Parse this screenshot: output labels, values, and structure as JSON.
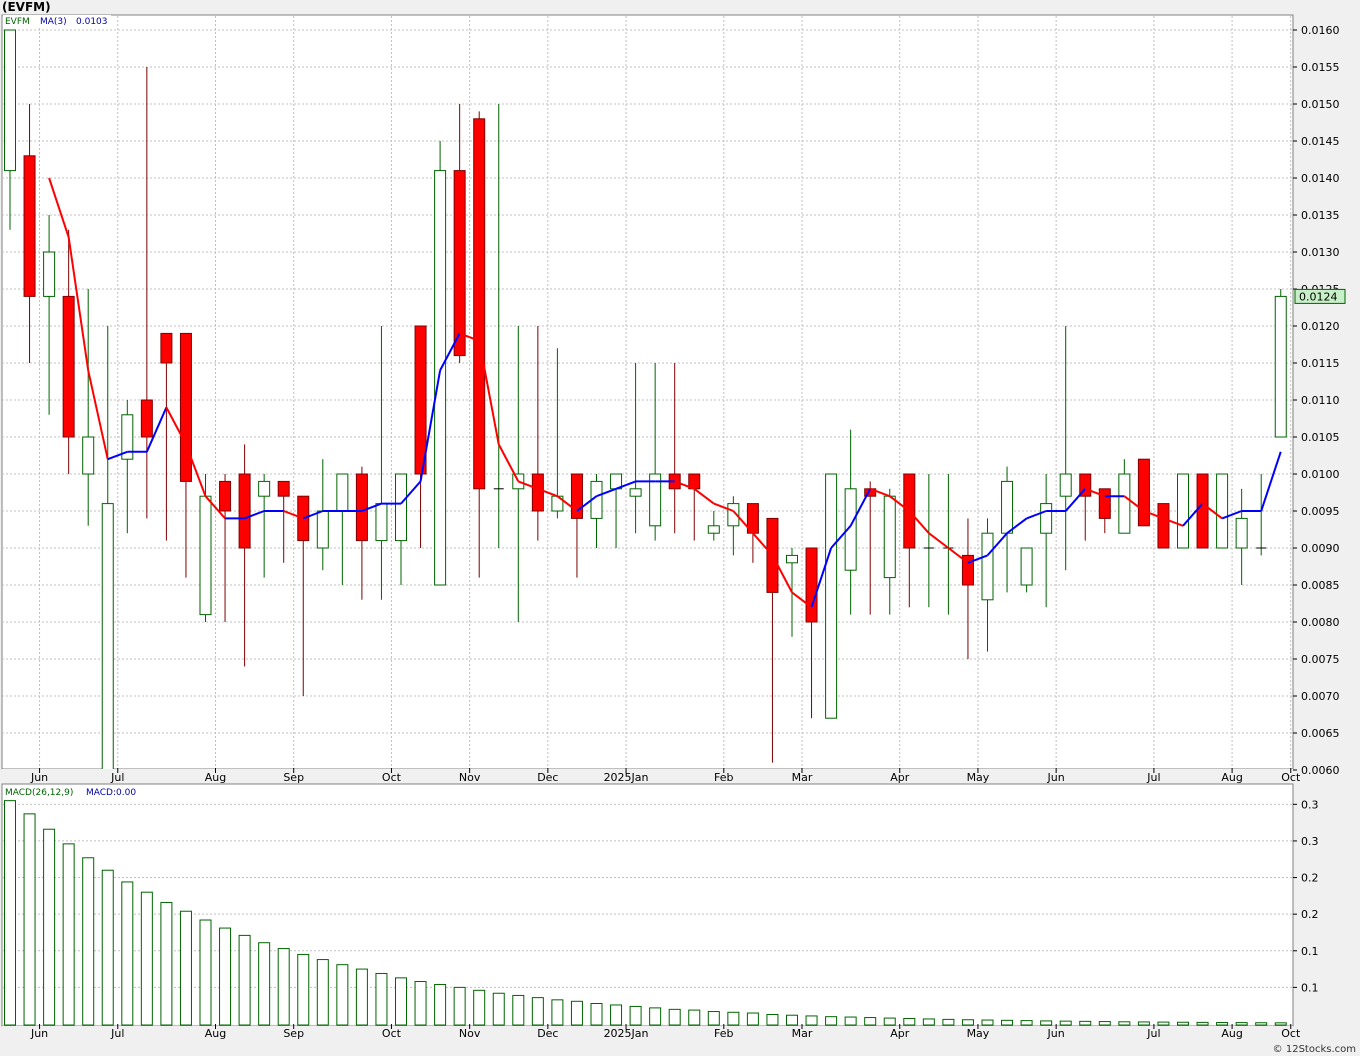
{
  "header": {
    "title": "(EVFM)"
  },
  "footer": {
    "credit": "© 12Stocks.com"
  },
  "colors": {
    "up": "#006400",
    "down": "#ff0000",
    "down_wick": "#800000",
    "ma_up": "#0000ff",
    "ma_down": "#ff0000",
    "macd": "#006400",
    "grid": "#c0c0c0",
    "panel_bg": "#ffffff"
  },
  "chart_data": [
    {
      "type": "candlestick",
      "legend": {
        "symbol": "EVFM",
        "ma_label": "MA(3)",
        "ma_value": "0.0103"
      },
      "last_price_label": "0.0124",
      "ylim": [
        0.0058,
        0.0162
      ],
      "y_ticks": [
        "0.0160",
        "0.0155",
        "0.0150",
        "0.0145",
        "0.0140",
        "0.0135",
        "0.0130",
        "0.0125",
        "0.0120",
        "0.0115",
        "0.0110",
        "0.0105",
        "0.0100",
        "0.0095",
        "0.0090",
        "0.0085",
        "0.0080",
        "0.0075",
        "0.0070",
        "0.0065",
        "0.0060"
      ],
      "x_ticks": [
        {
          "label": "Jun",
          "i": 1
        },
        {
          "label": "Jul",
          "i": 5
        },
        {
          "label": "Aug",
          "i": 10
        },
        {
          "label": "Sep",
          "i": 14
        },
        {
          "label": "Oct",
          "i": 19
        },
        {
          "label": "Nov",
          "i": 23
        },
        {
          "label": "Dec",
          "i": 27
        },
        {
          "label": "2025Jan",
          "i": 31
        },
        {
          "label": "Feb",
          "i": 36
        },
        {
          "label": "Mar",
          "i": 40
        },
        {
          "label": "Apr",
          "i": 45
        },
        {
          "label": "May",
          "i": 49
        },
        {
          "label": "Jun",
          "i": 53
        },
        {
          "label": "Jul",
          "i": 58
        },
        {
          "label": "Aug",
          "i": 62
        },
        {
          "label": "Oct",
          "i": 65
        }
      ],
      "candles": [
        {
          "o": 0.0141,
          "h": 0.016,
          "l": 0.0133,
          "c": 0.016
        },
        {
          "o": 0.0143,
          "h": 0.015,
          "l": 0.0115,
          "c": 0.0124
        },
        {
          "o": 0.0124,
          "h": 0.0135,
          "l": 0.0108,
          "c": 0.013
        },
        {
          "o": 0.0124,
          "h": 0.0133,
          "l": 0.01,
          "c": 0.0105
        },
        {
          "o": 0.01,
          "h": 0.0125,
          "l": 0.0093,
          "c": 0.0105
        },
        {
          "o": 0.006,
          "h": 0.012,
          "l": 0.006,
          "c": 0.0096
        },
        {
          "o": 0.0102,
          "h": 0.011,
          "l": 0.0092,
          "c": 0.0108
        },
        {
          "o": 0.011,
          "h": 0.0155,
          "l": 0.0094,
          "c": 0.0105
        },
        {
          "o": 0.0119,
          "h": 0.0119,
          "l": 0.0091,
          "c": 0.0115
        },
        {
          "o": 0.0119,
          "h": 0.0119,
          "l": 0.0086,
          "c": 0.0099
        },
        {
          "o": 0.0081,
          "h": 0.01,
          "l": 0.008,
          "c": 0.0097
        },
        {
          "o": 0.0099,
          "h": 0.01,
          "l": 0.008,
          "c": 0.0095
        },
        {
          "o": 0.01,
          "h": 0.0104,
          "l": 0.0074,
          "c": 0.009
        },
        {
          "o": 0.0097,
          "h": 0.01,
          "l": 0.0086,
          "c": 0.0099
        },
        {
          "o": 0.0099,
          "h": 0.0099,
          "l": 0.0088,
          "c": 0.0097
        },
        {
          "o": 0.0097,
          "h": 0.0097,
          "l": 0.007,
          "c": 0.0091
        },
        {
          "o": 0.009,
          "h": 0.0102,
          "l": 0.0087,
          "c": 0.0095
        },
        {
          "o": 0.0095,
          "h": 0.01,
          "l": 0.0085,
          "c": 0.01
        },
        {
          "o": 0.01,
          "h": 0.0101,
          "l": 0.0083,
          "c": 0.0091
        },
        {
          "o": 0.0091,
          "h": 0.012,
          "l": 0.0083,
          "c": 0.0096
        },
        {
          "o": 0.0091,
          "h": 0.01,
          "l": 0.0085,
          "c": 0.01
        },
        {
          "o": 0.012,
          "h": 0.012,
          "l": 0.009,
          "c": 0.01
        },
        {
          "o": 0.0085,
          "h": 0.0145,
          "l": 0.0085,
          "c": 0.0141
        },
        {
          "o": 0.0141,
          "h": 0.015,
          "l": 0.0115,
          "c": 0.0116
        },
        {
          "o": 0.0148,
          "h": 0.0149,
          "l": 0.0086,
          "c": 0.0098
        },
        {
          "o": 0.0098,
          "h": 0.015,
          "l": 0.009,
          "c": 0.0098
        },
        {
          "o": 0.0098,
          "h": 0.012,
          "l": 0.008,
          "c": 0.01
        },
        {
          "o": 0.01,
          "h": 0.012,
          "l": 0.0091,
          "c": 0.0095
        },
        {
          "o": 0.0095,
          "h": 0.0117,
          "l": 0.0094,
          "c": 0.0097
        },
        {
          "o": 0.01,
          "h": 0.01,
          "l": 0.0086,
          "c": 0.0094
        },
        {
          "o": 0.0094,
          "h": 0.01,
          "l": 0.009,
          "c": 0.0099
        },
        {
          "o": 0.0098,
          "h": 0.01,
          "l": 0.009,
          "c": 0.01
        },
        {
          "o": 0.0097,
          "h": 0.0115,
          "l": 0.0092,
          "c": 0.0098
        },
        {
          "o": 0.0093,
          "h": 0.0115,
          "l": 0.0091,
          "c": 0.01
        },
        {
          "o": 0.01,
          "h": 0.0115,
          "l": 0.0092,
          "c": 0.0098
        },
        {
          "o": 0.01,
          "h": 0.01,
          "l": 0.0091,
          "c": 0.0098
        },
        {
          "o": 0.0092,
          "h": 0.0095,
          "l": 0.0091,
          "c": 0.0093
        },
        {
          "o": 0.0093,
          "h": 0.0097,
          "l": 0.0089,
          "c": 0.0096
        },
        {
          "o": 0.0096,
          "h": 0.0096,
          "l": 0.0088,
          "c": 0.0092
        },
        {
          "o": 0.0094,
          "h": 0.0094,
          "l": 0.0061,
          "c": 0.0084
        },
        {
          "o": 0.0088,
          "h": 0.009,
          "l": 0.0078,
          "c": 0.0089
        },
        {
          "o": 0.009,
          "h": 0.009,
          "l": 0.0067,
          "c": 0.008
        },
        {
          "o": 0.0067,
          "h": 0.01,
          "l": 0.0067,
          "c": 0.01
        },
        {
          "o": 0.0087,
          "h": 0.0106,
          "l": 0.0081,
          "c": 0.0098
        },
        {
          "o": 0.0098,
          "h": 0.0099,
          "l": 0.0081,
          "c": 0.0097
        },
        {
          "o": 0.0086,
          "h": 0.0098,
          "l": 0.0081,
          "c": 0.0097
        },
        {
          "o": 0.01,
          "h": 0.01,
          "l": 0.0082,
          "c": 0.009
        },
        {
          "o": 0.009,
          "h": 0.01,
          "l": 0.0082,
          "c": 0.009
        },
        {
          "o": 0.009,
          "h": 0.01,
          "l": 0.0081,
          "c": 0.009
        },
        {
          "o": 0.0089,
          "h": 0.0094,
          "l": 0.0075,
          "c": 0.0085
        },
        {
          "o": 0.0083,
          "h": 0.0094,
          "l": 0.0076,
          "c": 0.0092
        },
        {
          "o": 0.0092,
          "h": 0.0101,
          "l": 0.0084,
          "c": 0.0099
        },
        {
          "o": 0.0085,
          "h": 0.009,
          "l": 0.0084,
          "c": 0.009
        },
        {
          "o": 0.0092,
          "h": 0.01,
          "l": 0.0082,
          "c": 0.0096
        },
        {
          "o": 0.0097,
          "h": 0.012,
          "l": 0.0087,
          "c": 0.01
        },
        {
          "o": 0.01,
          "h": 0.01,
          "l": 0.0091,
          "c": 0.0097
        },
        {
          "o": 0.0098,
          "h": 0.0098,
          "l": 0.0092,
          "c": 0.0094
        },
        {
          "o": 0.0092,
          "h": 0.0102,
          "l": 0.0092,
          "c": 0.01
        },
        {
          "o": 0.0102,
          "h": 0.0102,
          "l": 0.0093,
          "c": 0.0093
        },
        {
          "o": 0.0096,
          "h": 0.0096,
          "l": 0.009,
          "c": 0.009
        },
        {
          "o": 0.009,
          "h": 0.01,
          "l": 0.009,
          "c": 0.01
        },
        {
          "o": 0.01,
          "h": 0.01,
          "l": 0.009,
          "c": 0.009
        },
        {
          "o": 0.009,
          "h": 0.01,
          "l": 0.009,
          "c": 0.01
        },
        {
          "o": 0.009,
          "h": 0.0098,
          "l": 0.0085,
          "c": 0.0094
        },
        {
          "o": 0.009,
          "h": 0.01,
          "l": 0.0089,
          "c": 0.009
        },
        {
          "o": 0.0105,
          "h": 0.0125,
          "l": 0.0105,
          "c": 0.0124
        }
      ],
      "ma3": [
        null,
        null,
        0.014,
        0.0132,
        0.0114,
        0.0102,
        0.0103,
        0.0103,
        0.0109,
        0.0104,
        0.0097,
        0.0094,
        0.0094,
        0.0095,
        0.0095,
        0.0094,
        0.0095,
        0.0095,
        0.0095,
        0.0096,
        0.0096,
        0.0099,
        0.0114,
        0.0119,
        0.0118,
        0.0104,
        0.0099,
        0.0098,
        0.0097,
        0.0095,
        0.0097,
        0.0098,
        0.0099,
        0.0099,
        0.0099,
        0.0098,
        0.0096,
        0.0095,
        0.0092,
        0.0089,
        0.0084,
        0.0082,
        0.009,
        0.0093,
        0.0098,
        0.0097,
        0.0095,
        0.0092,
        0.009,
        0.0088,
        0.0089,
        0.0092,
        0.0094,
        0.0095,
        0.0095,
        0.0098,
        0.0097,
        0.0097,
        0.0095,
        0.0094,
        0.0093,
        0.0096,
        0.0094,
        0.0095,
        0.0095,
        0.0103
      ],
      "macd_panel": {
        "legend": {
          "label": "MACD(26,12,9)",
          "value_label": "MACD:0.00"
        },
        "y_ticks": [
          "0.3",
          "0.3",
          "0.2",
          "0.2",
          "0.1",
          "0.1"
        ],
        "y_tick_values": [
          0.3,
          0.25,
          0.2,
          0.15,
          0.1,
          0.05
        ],
        "ylim": [
          0,
          0.31
        ],
        "values": [
          0.305,
          0.287,
          0.266,
          0.246,
          0.227,
          0.21,
          0.194,
          0.18,
          0.166,
          0.154,
          0.142,
          0.131,
          0.121,
          0.111,
          0.103,
          0.095,
          0.088,
          0.081,
          0.075,
          0.069,
          0.063,
          0.058,
          0.054,
          0.05,
          0.046,
          0.042,
          0.039,
          0.036,
          0.033,
          0.031,
          0.028,
          0.026,
          0.024,
          0.022,
          0.02,
          0.019,
          0.017,
          0.016,
          0.015,
          0.013,
          0.012,
          0.011,
          0.01,
          0.0095,
          0.0088,
          0.0081,
          0.0075,
          0.0069,
          0.0063,
          0.0058,
          0.0054,
          0.005,
          0.0046,
          0.0042,
          0.0039,
          0.0036,
          0.0033,
          0.003,
          0.0028,
          0.0026,
          0.0024,
          0.0022,
          0.002,
          0.0019,
          0.0017,
          0.0016
        ]
      }
    }
  ]
}
